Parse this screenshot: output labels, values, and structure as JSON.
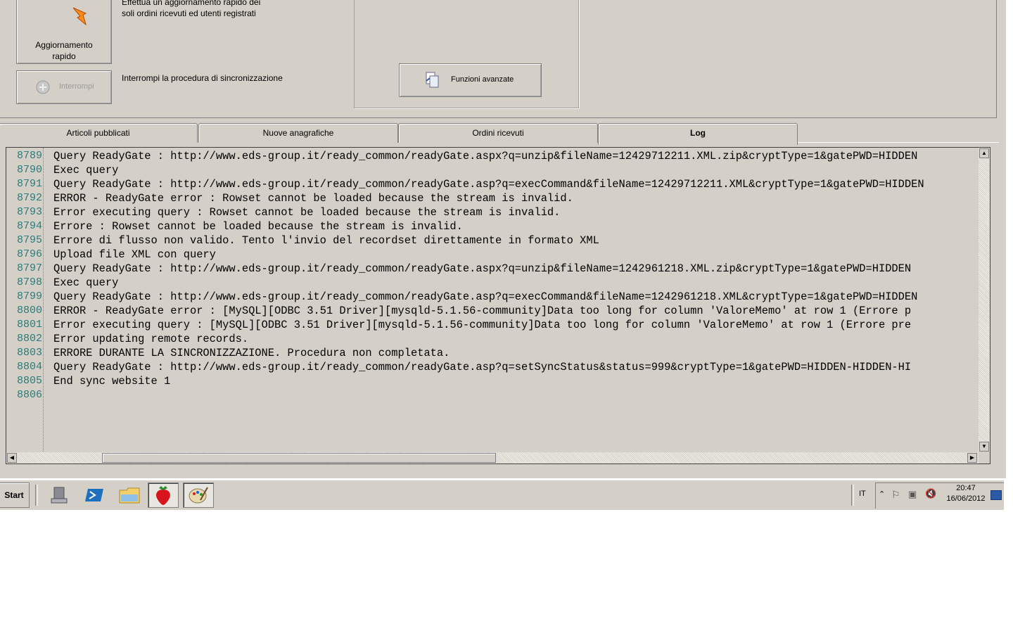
{
  "toolbar": {
    "quick_update_label": "Aggiornamento rapido",
    "quick_update_desc_line1": "Effettua un aggiornamento rapido dei",
    "quick_update_desc_line2": "soli ordini ricevuti ed utenti registrati",
    "stop_label": "Interrompi",
    "stop_desc": "Interrompi la procedura di sincronizzazione",
    "advanced_label": "Funzioni avanzate"
  },
  "tabs": [
    {
      "label": "Articoli pubblicati",
      "active": false
    },
    {
      "label": "Nuove anagrafiche",
      "active": false
    },
    {
      "label": "Ordini ricevuti",
      "active": false
    },
    {
      "label": "Log",
      "active": true
    }
  ],
  "log": {
    "lines": [
      {
        "n": "8789",
        "text": "Query ReadyGate : http://www.eds-group.it/ready_common/readyGate.aspx?q=unzip&fileName=12429712211.XML.zip&cryptType=1&gatePWD=HIDDEN"
      },
      {
        "n": "8790",
        "text": "Exec query"
      },
      {
        "n": "8791",
        "text": "Query ReadyGate : http://www.eds-group.it/ready_common/readyGate.asp?q=execCommand&fileName=12429712211.XML&cryptType=1&gatePWD=HIDDEN"
      },
      {
        "n": "8792",
        "text": "ERROR - ReadyGate error : Rowset cannot be loaded because the stream is invalid."
      },
      {
        "n": "8793",
        "text": "Error executing query : Rowset cannot be loaded because the stream is invalid."
      },
      {
        "n": "8794",
        "text": "Errore : Rowset cannot be loaded because the stream is invalid."
      },
      {
        "n": "8795",
        "text": "Errore di flusso non valido. Tento l'invio del recordset direttamente in formato XML"
      },
      {
        "n": "8796",
        "text": "Upload file XML con query"
      },
      {
        "n": "8797",
        "text": "Query ReadyGate : http://www.eds-group.it/ready_common/readyGate.aspx?q=unzip&fileName=1242961218.XML.zip&cryptType=1&gatePWD=HIDDEN"
      },
      {
        "n": "8798",
        "text": "Exec query"
      },
      {
        "n": "8799",
        "text": "Query ReadyGate : http://www.eds-group.it/ready_common/readyGate.asp?q=execCommand&fileName=1242961218.XML&cryptType=1&gatePWD=HIDDEN"
      },
      {
        "n": "8800",
        "text": "ERROR - ReadyGate error : [MySQL][ODBC 3.51 Driver][mysqld-5.1.56-community]Data too long for column 'ValoreMemo' at row 1 (Errore p"
      },
      {
        "n": "8801",
        "text": "Error executing query : [MySQL][ODBC 3.51 Driver][mysqld-5.1.56-community]Data too long for column 'ValoreMemo' at row 1 (Errore pre"
      },
      {
        "n": "8802",
        "text": "Error updating remote records."
      },
      {
        "n": "8803",
        "text": "ERRORE DURANTE LA SINCRONIZZAZIONE. Procedura non completata."
      },
      {
        "n": "8804",
        "text": "Query ReadyGate : http://www.eds-group.it/ready_common/readyGate.asp?q=setSyncStatus&status=999&cryptType=1&gatePWD=HIDDEN-HIDDEN-HI"
      },
      {
        "n": "8805",
        "text": "End sync website 1"
      },
      {
        "n": "8806",
        "text": ""
      }
    ]
  },
  "taskbar": {
    "start_label": "Start",
    "language": "IT",
    "time": "20:47",
    "date": "16/06/2012",
    "icons": [
      "server-manager-icon",
      "powershell-icon",
      "file-explorer-icon",
      "strawberry-app-icon",
      "paint-icon"
    ]
  }
}
